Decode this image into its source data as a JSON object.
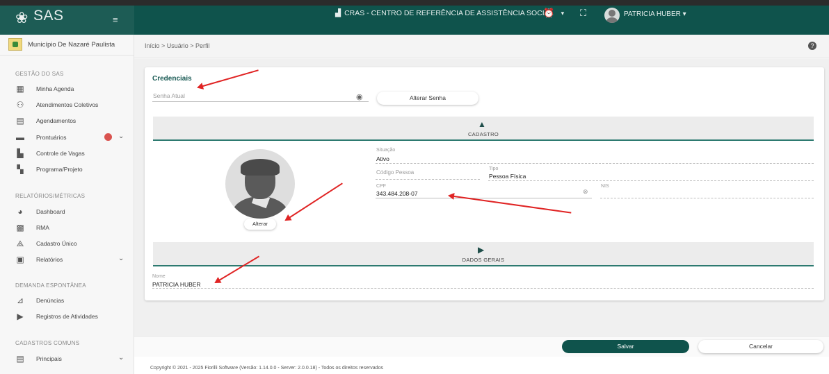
{
  "header": {
    "brand": "SAS",
    "org_name": "CRAS - CENTRO DE REFERÊNCIA DE ASSISTÊNCIA SOCIAL",
    "user_name": "PATRICIA HUBER"
  },
  "sidebar": {
    "municipality": "Município De Nazaré Paulista",
    "sections": [
      {
        "title": "GESTÃO DO SAS",
        "items": [
          {
            "label": "Minha Agenda",
            "icon": "calendar-icon"
          },
          {
            "label": "Atendimentos Coletivos",
            "icon": "group-icon"
          },
          {
            "label": "Agendamentos",
            "icon": "calendar-check-icon"
          },
          {
            "label": "Prontuários",
            "icon": "folder-icon"
          },
          {
            "label": "Controle de Vagas",
            "icon": "chart-icon"
          },
          {
            "label": "Programa/Projeto",
            "icon": "building-icon"
          }
        ]
      },
      {
        "title": "RELATÓRIOS/MÉTRICAS",
        "items": [
          {
            "label": "Dashboard",
            "icon": "pie-icon"
          },
          {
            "label": "RMA",
            "icon": "bar-chart-icon"
          },
          {
            "label": "Cadastro Único",
            "icon": "handshake-icon"
          },
          {
            "label": "Relatórios",
            "icon": "file-icon"
          }
        ]
      },
      {
        "title": "DEMANDA ESPONTÂNEA",
        "items": [
          {
            "label": "Denúncias",
            "icon": "megaphone-icon"
          },
          {
            "label": "Registros de Atividades",
            "icon": "edit-icon"
          }
        ]
      },
      {
        "title": "CADASTROS COMUNS",
        "items": [
          {
            "label": "Principais",
            "icon": "list-icon"
          }
        ]
      }
    ]
  },
  "breadcrumb": "Início > Usuário > Perfil",
  "credentials": {
    "title": "Credenciais",
    "password_placeholder": "Senha Atual",
    "change_password_label": "Alterar Senha"
  },
  "cadastro": {
    "title": "CADASTRO",
    "change_photo_label": "Alterar",
    "situacao_label": "Situação",
    "situacao_value": "Ativo",
    "codigo_label": "Código Pessoa",
    "tipo_label": "Tipo",
    "tipo_value": "Pessoa Física",
    "cpf_label": "CPF",
    "cpf_value": "343.484.208-07",
    "nis_label": "NIS"
  },
  "dados_gerais": {
    "title": "DADOS GERAIS",
    "nome_label": "Nome",
    "nome_value": "PATRICIA HUBER"
  },
  "footer": {
    "save_label": "Salvar",
    "cancel_label": "Cancelar",
    "copyright": "Copyright © 2021 - 2025 Fiorilli Software (Versão: 1.14.0.0 - Server: 2.0.0.18) - Todos os direitos reservados"
  },
  "colors": {
    "primary": "#0f534c",
    "annotation_arrow": "#e02424"
  }
}
